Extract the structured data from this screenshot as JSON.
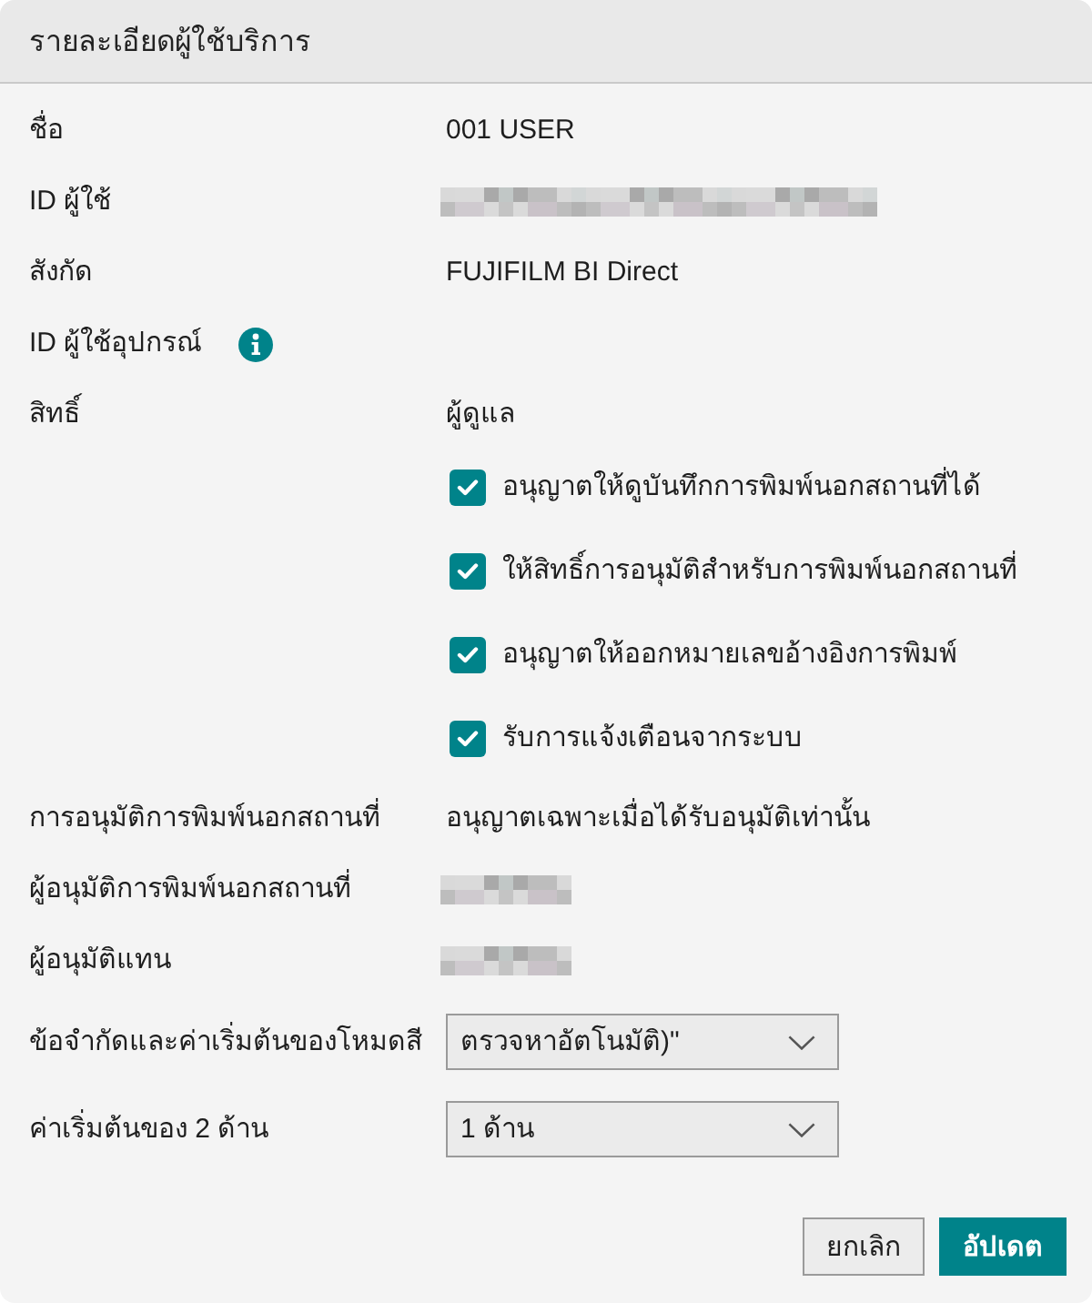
{
  "dialog": {
    "title": "รายละเอียดผู้ใช้บริการ"
  },
  "fields": [
    {
      "kind": "text",
      "label": "ชื่อ",
      "value": "001 USER"
    },
    {
      "kind": "redactedwide",
      "label": "ID ผู้ใช้"
    },
    {
      "kind": "text",
      "label": "สังกัด",
      "value": "FUJIFILM BI Direct"
    },
    {
      "kind": "info",
      "label": "ID ผู้ใช้อุปกรณ์"
    },
    {
      "kind": "text",
      "label": "สิทธิ์",
      "value": "ผู้ดูแล",
      "options": [
        {
          "label": "อนุญาตให้ดูบันทึกการพิมพ์นอกสถานที่ได้",
          "checked": true
        },
        {
          "label": "ให้สิทธิ์การอนุมัติสำหรับการพิมพ์นอกสถานที่",
          "checked": true
        },
        {
          "label": "อนุญาตให้ออกหมายเลขอ้างอิงการพิมพ์",
          "checked": true
        },
        {
          "label": "รับการแจ้งเตือนจากระบบ",
          "checked": true
        }
      ]
    },
    {
      "kind": "text",
      "label": "การอนุมัติการพิมพ์นอกสถานที่",
      "value": "อนุญาตเฉพาะเมื่อได้รับอนุมัติเท่านั้น"
    },
    {
      "kind": "redactednarrow",
      "label": "ผู้อนุมัติการพิมพ์นอกสถานที่"
    },
    {
      "kind": "redactednarrow",
      "label": "ผู้อนุมัติแทน"
    },
    {
      "kind": "select",
      "label": "ข้อจำกัดและค่าเริ่มต้นของโหมดสี",
      "value": "ตรวจหาอัตโนมัติ)\""
    },
    {
      "kind": "select",
      "label": "ค่าเริ่มต้นของ 2 ด้าน",
      "value": "1 ด้าน"
    }
  ],
  "buttons": [
    {
      "label": "ยกเลิก",
      "kind": "secondary"
    },
    {
      "label": "อัปเดต",
      "kind": "primary"
    }
  ]
}
